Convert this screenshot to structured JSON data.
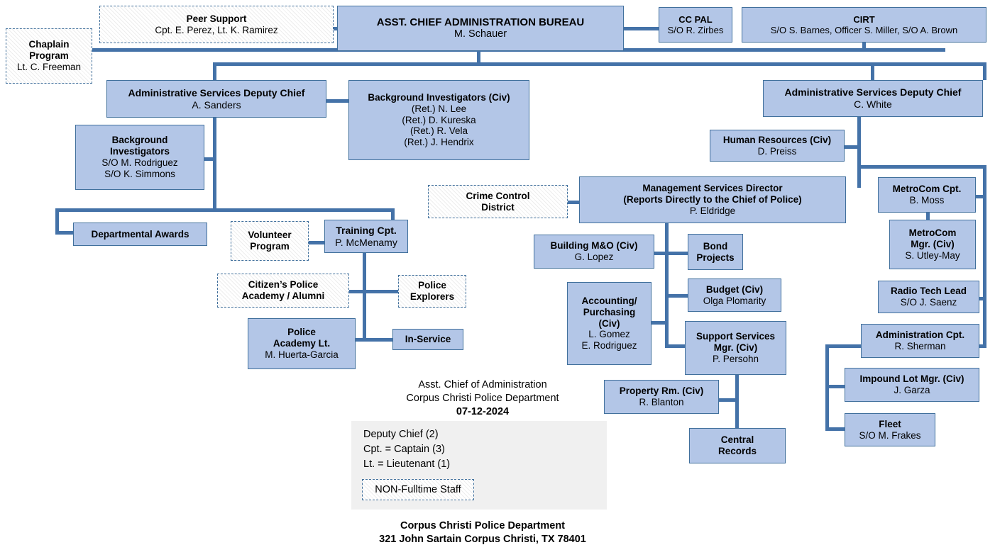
{
  "chart_meta": {
    "type": "org-chart",
    "title": "Asst. Chief of Administration Organizational Chart",
    "accent_color": "#4472a8",
    "box_fill": "#b3c6e7",
    "box_border": "#41709c",
    "legend_panel_fill": "#f0f0f0"
  },
  "nodes": {
    "chaplain": {
      "title": "Chaplain",
      "title2": "Program",
      "sub": "Lt. C. Freeman"
    },
    "peer_support": {
      "title": "Peer Support",
      "sub": "Cpt. E. Perez, Lt. K. Ramirez"
    },
    "asst_chief": {
      "title": "ASST. CHIEF ADMINISTRATION BUREAU",
      "sub": "M. Schauer"
    },
    "cc_pal": {
      "title": "CC PAL",
      "sub": "S/O R. Zirbes"
    },
    "cirt": {
      "title": "CIRT",
      "sub": "S/O S. Barnes, Officer S. Miller, S/O A. Brown"
    },
    "asd_left": {
      "title": "Administrative Services Deputy Chief",
      "sub": "A. Sanders"
    },
    "bg_inv_civ": {
      "title": "Background Investigators  (Civ)",
      "sub1": "(Ret.) N. Lee",
      "sub2": "(Ret.) D. Kureska",
      "sub3": "(Ret.) R. Vela",
      "sub4": "(Ret.) J. Hendrix"
    },
    "bg_inv": {
      "title1": "Background",
      "title2": "Investigators",
      "sub1": "S/O M. Rodriguez",
      "sub2": "S/O K. Simmons"
    },
    "dept_awards": {
      "title": "Departmental Awards"
    },
    "volunteer": {
      "title1": "Volunteer",
      "title2": "Program"
    },
    "training_cpt": {
      "title": "Training  Cpt.",
      "sub": "P. McMenamy"
    },
    "citizens_academy": {
      "title1": "Citizen’s Police",
      "title2": "Academy / Alumni"
    },
    "police_explorers": {
      "title1": "Police",
      "title2": "Explorers"
    },
    "police_academy_lt": {
      "title1": "Police",
      "title2": "Academy Lt.",
      "sub": "M. Huerta-Garcia"
    },
    "in_service": {
      "title": "In-Service"
    },
    "crime_control": {
      "title1": "Crime Control",
      "title2": "District"
    },
    "mgmt_services": {
      "title1": "Management Services Director",
      "title2": "(Reports Directly to the Chief of Police)",
      "sub": "P. Eldridge"
    },
    "building_mo": {
      "title": "Building M&O (Civ)",
      "sub": "G. Lopez"
    },
    "bond_projects": {
      "title1": "Bond",
      "title2": "Projects"
    },
    "accounting": {
      "title1": "Accounting/",
      "title2": "Purchasing",
      "title3": "(Civ)",
      "sub1": "L. Gomez",
      "sub2": "E. Rodriguez"
    },
    "budget": {
      "title": "Budget (Civ)",
      "sub": "Olga Plomarity"
    },
    "support_services": {
      "title1": "Support Services",
      "title2": "Mgr. (Civ)",
      "sub": "P. Persohn"
    },
    "property_rm": {
      "title": "Property Rm. (Civ)",
      "sub": "R. Blanton"
    },
    "central_records": {
      "title1": "Central",
      "title2": "Records"
    },
    "asd_right": {
      "title": "Administrative Services Deputy Chief",
      "sub": "C. White"
    },
    "human_resources": {
      "title": "Human Resources (Civ)",
      "sub": "D. Preiss"
    },
    "metrocom_cpt": {
      "title": "MetroCom Cpt.",
      "sub": "B. Moss"
    },
    "metrocom_mgr": {
      "title1": "MetroCom",
      "title2": "Mgr. (Civ)",
      "sub": "S. Utley-May"
    },
    "radio_tech": {
      "title": "Radio Tech Lead",
      "sub": "S/O J. Saenz"
    },
    "administration_cpt": {
      "title": "Administration Cpt.",
      "sub": "R. Sherman"
    },
    "impound_lot": {
      "title": "Impound Lot Mgr. (Civ)",
      "sub": "J. Garza"
    },
    "fleet": {
      "title": "Fleet",
      "sub": "S/O M. Frakes"
    }
  },
  "caption": {
    "line1": "Asst. Chief of Administration",
    "line2": "Corpus Christi Police Department",
    "line3": "07-12-2024"
  },
  "legend": {
    "items": [
      "Deputy Chief (2)",
      "Cpt. = Captain (3)",
      "Lt. = Lieutenant (1)"
    ],
    "swatch_label": "NON-Fulltime Staff"
  },
  "footer": {
    "line1": "Corpus Christi Police Department",
    "line2": "321 John Sartain Corpus Christi, TX 78401"
  }
}
